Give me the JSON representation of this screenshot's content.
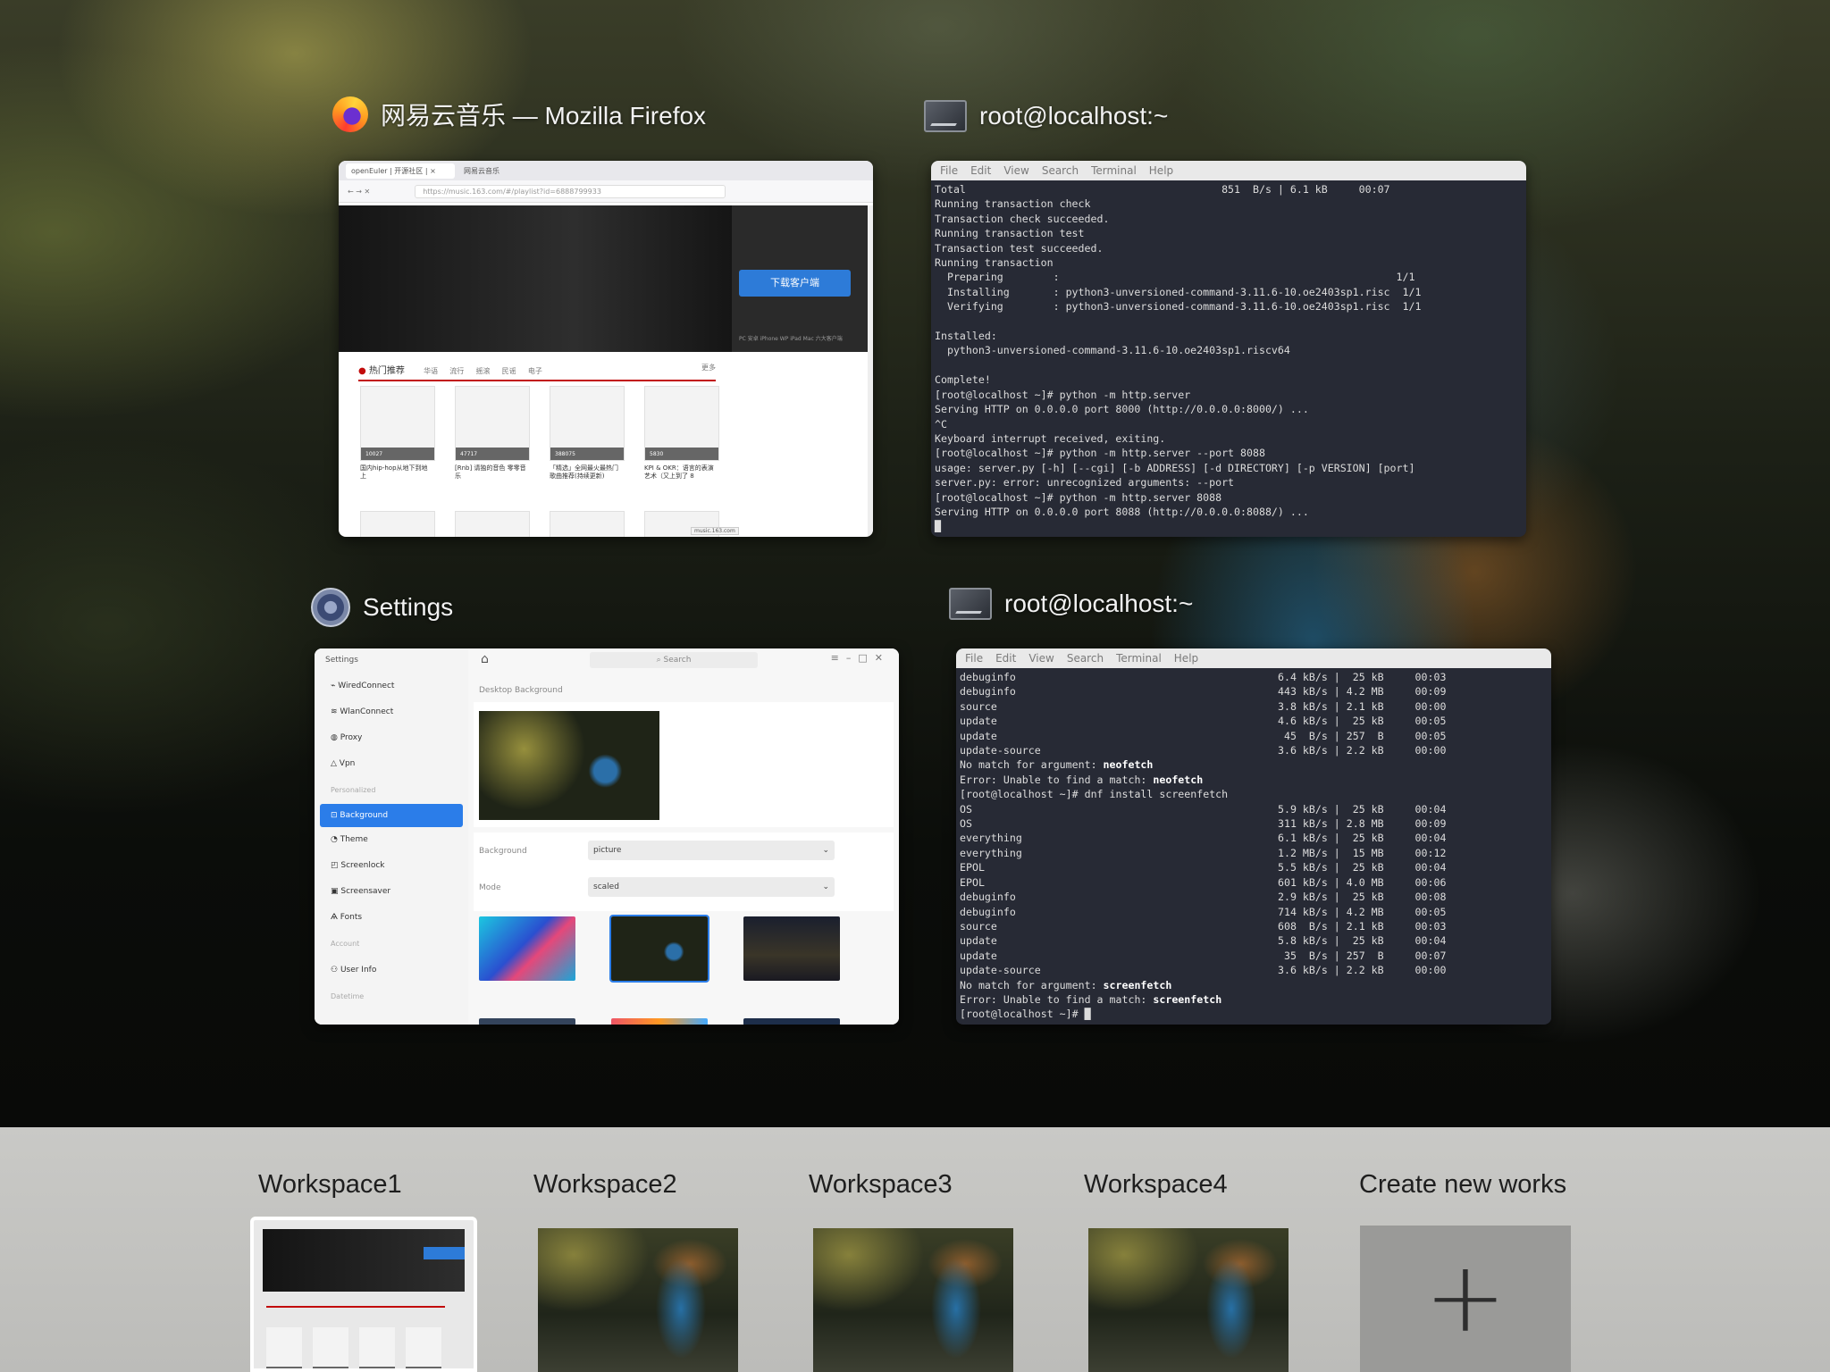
{
  "windows": {
    "firefox": {
      "title": "网易云音乐 — Mozilla Firefox",
      "tabs": [
        "openEuler | 开源社区 | ×",
        "网易云音乐"
      ],
      "url": "https://music.163.com/#/playlist?id=6888799933",
      "download_button": "下载客户端",
      "download_note": "PC 安卓 iPhone WP iPad Mac 六大客户端",
      "section_title": "热门推荐",
      "section_tabs": [
        "华语",
        "流行",
        "摇滚",
        "民谣",
        "电子"
      ],
      "section_more": "更多",
      "cards": [
        {
          "caption": "国内hip-hop从地下到地上",
          "plays": "10027"
        },
        {
          "caption": "[Rnb] 请独的音色 零零音乐",
          "plays": "47717"
        },
        {
          "caption": "「精选」全网最火最热门歌曲推荐(持续更新)",
          "plays": "388075"
        },
        {
          "caption": "KPI & OKR：语言的表演艺术（又上到了 8",
          "plays": "5830"
        }
      ],
      "status_url": "music.163.com"
    },
    "terminal1": {
      "title": "root@localhost:~",
      "menu": [
        "File",
        "Edit",
        "View",
        "Search",
        "Terminal",
        "Help"
      ],
      "lines": [
        "Total                                         851  B/s | 6.1 kB     00:07",
        "Running transaction check",
        "Transaction check succeeded.",
        "Running transaction test",
        "Transaction test succeeded.",
        "Running transaction",
        "  Preparing        :                                                      1/1",
        "  Installing       : python3-unversioned-command-3.11.6-10.oe2403sp1.risc  1/1",
        "  Verifying        : python3-unversioned-command-3.11.6-10.oe2403sp1.risc  1/1",
        "",
        "Installed:",
        "  python3-unversioned-command-3.11.6-10.oe2403sp1.riscv64",
        "",
        "Complete!",
        "[root@localhost ~]# python -m http.server",
        "Serving HTTP on 0.0.0.0 port 8000 (http://0.0.0.0:8000/) ...",
        "^C",
        "Keyboard interrupt received, exiting.",
        "[root@localhost ~]# python -m http.server --port 8088",
        "usage: server.py [-h] [--cgi] [-b ADDRESS] [-d DIRECTORY] [-p VERSION] [port]",
        "server.py: error: unrecognized arguments: --port",
        "[root@localhost ~]# python -m http.server 8088",
        "Serving HTTP on 0.0.0.0 port 8088 (http://0.0.0.0:8088/) ...",
        "█"
      ]
    },
    "settings": {
      "title": "Settings",
      "app_label": "Settings",
      "search_placeholder": "Search",
      "nav": [
        {
          "label": "WiredConnect",
          "icon": "plug-icon"
        },
        {
          "label": "WlanConnect",
          "icon": "wifi-icon"
        },
        {
          "label": "Proxy",
          "icon": "globe-icon"
        },
        {
          "label": "Vpn",
          "icon": "shield-icon"
        }
      ],
      "group_personalized": "Personalized",
      "nav2": [
        {
          "label": "Background",
          "icon": "image-icon",
          "active": true
        },
        {
          "label": "Theme",
          "icon": "palette-icon"
        },
        {
          "label": "Screenlock",
          "icon": "lock-icon"
        },
        {
          "label": "Screensaver",
          "icon": "monitor-icon"
        },
        {
          "label": "Fonts",
          "icon": "font-icon"
        }
      ],
      "group_account": "Account",
      "nav3": [
        {
          "label": "User Info",
          "icon": "user-icon"
        }
      ],
      "group_datetime": "Datetime",
      "section": "Desktop Background",
      "background_label": "Background",
      "background_value": "picture",
      "mode_label": "Mode",
      "mode_value": "scaled"
    },
    "terminal2": {
      "title": "root@localhost:~",
      "menu": [
        "File",
        "Edit",
        "View",
        "Search",
        "Terminal",
        "Help"
      ],
      "lines": [
        "debuginfo                                          6.4 kB/s |  25 kB     00:03",
        "debuginfo                                          443 kB/s | 4.2 MB     00:09",
        "source                                             3.8 kB/s | 2.1 kB     00:00",
        "update                                             4.6 kB/s |  25 kB     00:05",
        "update                                              45  B/s | 257  B     00:05",
        "update-source                                      3.6 kB/s | 2.2 kB     00:00",
        "No match for argument: neofetch",
        "Error: Unable to find a match: neofetch",
        "[root@localhost ~]# dnf install screenfetch",
        "OS                                                 5.9 kB/s |  25 kB     00:04",
        "OS                                                 311 kB/s | 2.8 MB     00:09",
        "everything                                         6.1 kB/s |  25 kB     00:04",
        "everything                                         1.2 MB/s |  15 MB     00:12",
        "EPOL                                               5.5 kB/s |  25 kB     00:04",
        "EPOL                                               601 kB/s | 4.0 MB     00:06",
        "debuginfo                                          2.9 kB/s |  25 kB     00:08",
        "debuginfo                                          714 kB/s | 4.2 MB     00:05",
        "source                                             608  B/s | 2.1 kB     00:03",
        "update                                             5.8 kB/s |  25 kB     00:04",
        "update                                              35  B/s | 257  B     00:07",
        "update-source                                      3.6 kB/s | 2.2 kB     00:00",
        "No match for argument: screenfetch",
        "Error: Unable to find a match: screenfetch",
        "[root@localhost ~]# █"
      ]
    }
  },
  "workspaces": {
    "items": [
      "Workspace1",
      "Workspace2",
      "Workspace3",
      "Workspace4"
    ],
    "current": "Workspace1",
    "create_label": "Create new works",
    "create_symbol": "+"
  }
}
